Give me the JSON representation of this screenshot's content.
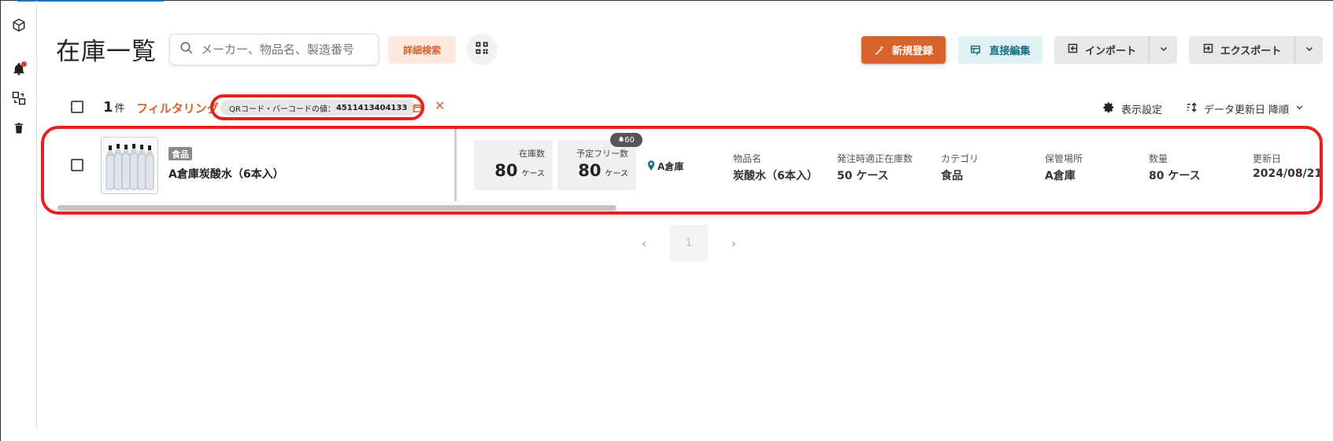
{
  "page": {
    "title": "在庫一覧"
  },
  "sidebar": {
    "items": [
      {
        "icon": "box-icon"
      },
      {
        "icon": "bell-icon",
        "has_notification": true
      },
      {
        "icon": "transfer-icon"
      },
      {
        "icon": "trash-icon"
      }
    ]
  },
  "header": {
    "search_placeholder": "メーカー、物品名、製造番号",
    "detail_search_label": "詳細検索",
    "new_label": "新規登録",
    "direct_edit_label": "直接編集",
    "import_label": "インポート",
    "export_label": "エクスポート"
  },
  "toolbar": {
    "count_value": "1",
    "count_unit": "件",
    "filter_label": "フィルタリング",
    "filter_chip_prefix": "QRコード・バーコードの値：",
    "filter_chip_value": "4511413404133",
    "clear_symbol": "✕",
    "display_settings_label": "表示設定",
    "sort_label": "データ更新日 降順"
  },
  "item": {
    "category_tag": "食品",
    "name": "A倉庫炭酸水（6本入）",
    "stock": {
      "label": "在庫数",
      "value": "80",
      "unit": "ケース"
    },
    "free_stock": {
      "label": "予定フリー数",
      "value": "80",
      "unit": "ケース"
    },
    "alert_badge": "60",
    "location": "A倉庫",
    "columns": [
      {
        "header": "物品名",
        "value": "炭酸水（6本入）"
      },
      {
        "header": "発注時適正在庫数",
        "value": "50 ケース"
      },
      {
        "header": "カテゴリ",
        "value": "食品"
      },
      {
        "header": "保管場所",
        "value": "A倉庫"
      },
      {
        "header": "数量",
        "value": "80 ケース"
      },
      {
        "header": "更新日",
        "value": "2024/08/21"
      }
    ]
  },
  "pagination": {
    "current": "1",
    "prev_symbol": "‹",
    "next_symbol": "›"
  },
  "colors": {
    "accent": "#d9622b",
    "highlight_red": "#e8201d",
    "teal": "#156f80"
  }
}
